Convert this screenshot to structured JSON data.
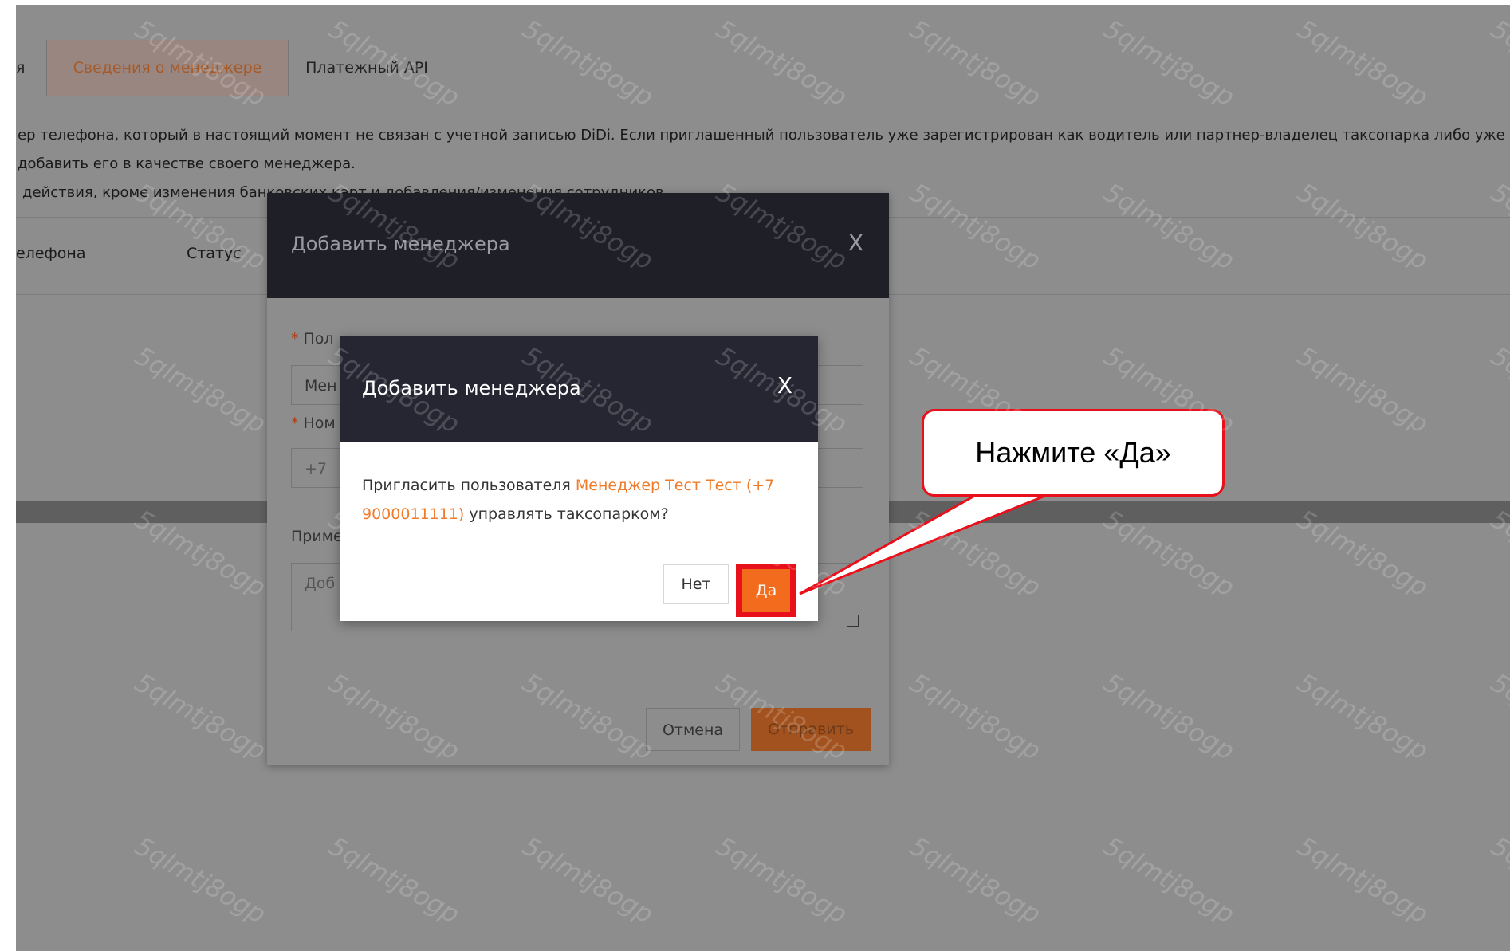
{
  "tabs": {
    "partial_label": "я",
    "active_label": "Сведения о менеджере",
    "api_label": "Платежный API"
  },
  "info": {
    "line1": "ер телефона, который в настоящий момент не связан с учетной записью DiDi. Если приглашенный пользователь уже зарегистрирован как водитель или партнер-владелец таксопарка либо уже",
    "line2": "добавить его в качестве своего менеджера.",
    "line3": "действия, кроме изменения банковских карт и добавления/изменения сотрудников."
  },
  "table": {
    "col_phone": "елефона",
    "col_status": "Статус"
  },
  "modal_outer": {
    "title": "Добавить менеджера",
    "close": "X",
    "field1_label": "Пол",
    "field1_value": "Мен",
    "field2_label": "Ном",
    "field2_value": "+7",
    "notes_label": "Приме",
    "notes_placeholder": "Доб",
    "cancel_label": "Отмена",
    "submit_label": "Отправить"
  },
  "modal_confirm": {
    "title": "Добавить менеджера",
    "close": "X",
    "text_before": "Пригласить пользователя ",
    "highlight_1": "Менеджер Тест Тест (+7",
    "highlight_2": "9000011111)",
    "text_after": " управлять таксопарком?",
    "no_label": "Нет",
    "yes_label": "Да"
  },
  "callout": {
    "text": "Нажмите «Да»"
  },
  "watermark": {
    "text": "5qlmtj8ogp"
  },
  "colors": {
    "accent": "#f36b1c",
    "highlight": "#e8101a",
    "modal_header": "#262633"
  }
}
